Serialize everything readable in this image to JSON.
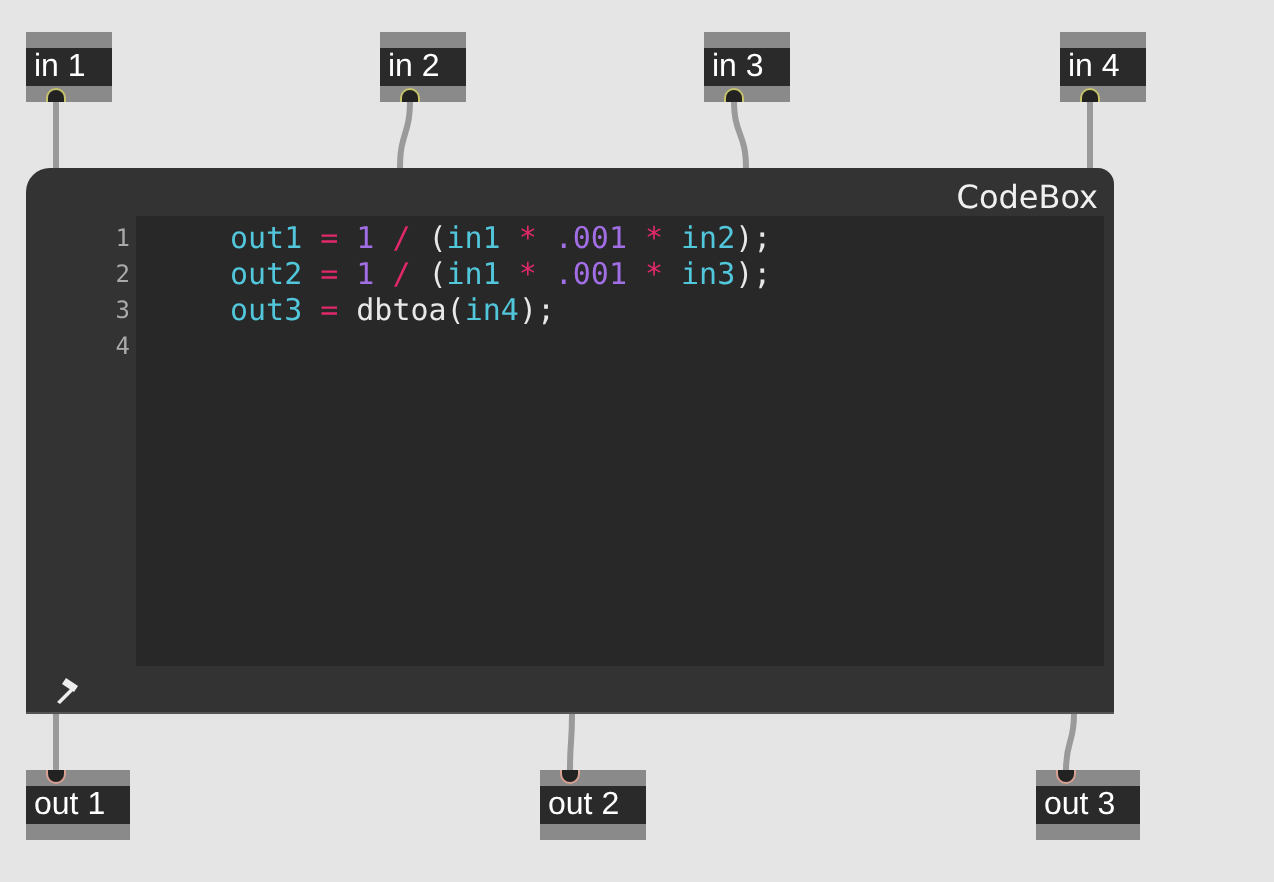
{
  "inlets": [
    {
      "label": "in 1"
    },
    {
      "label": "in 2"
    },
    {
      "label": "in 3"
    },
    {
      "label": "in 4"
    }
  ],
  "codebox": {
    "title": "CodeBox",
    "lines": [
      {
        "number": "1",
        "tokens": [
          {
            "kind": "ident",
            "text": "out1"
          },
          {
            "kind": "op",
            "text": "="
          },
          {
            "kind": "num",
            "text": "1"
          },
          {
            "kind": "op",
            "text": "/"
          },
          {
            "kind": "plain",
            "text": "("
          },
          {
            "kind": "ident",
            "text": "in1"
          },
          {
            "kind": "op",
            "text": "*"
          },
          {
            "kind": "num",
            "text": ".001"
          },
          {
            "kind": "op",
            "text": "*"
          },
          {
            "kind": "ident",
            "text": "in2"
          },
          {
            "kind": "plain",
            "text": ");"
          }
        ]
      },
      {
        "number": "2",
        "tokens": [
          {
            "kind": "ident",
            "text": "out2"
          },
          {
            "kind": "op",
            "text": "="
          },
          {
            "kind": "num",
            "text": "1"
          },
          {
            "kind": "op",
            "text": "/"
          },
          {
            "kind": "plain",
            "text": "("
          },
          {
            "kind": "ident",
            "text": "in1"
          },
          {
            "kind": "op",
            "text": "*"
          },
          {
            "kind": "num",
            "text": ".001"
          },
          {
            "kind": "op",
            "text": "*"
          },
          {
            "kind": "ident",
            "text": "in3"
          },
          {
            "kind": "plain",
            "text": ");"
          }
        ]
      },
      {
        "number": "3",
        "tokens": [
          {
            "kind": "ident",
            "text": "out3"
          },
          {
            "kind": "op",
            "text": "="
          },
          {
            "kind": "plain",
            "text": "dbtoa("
          },
          {
            "kind": "ident",
            "text": "in4"
          },
          {
            "kind": "plain",
            "text": ");"
          }
        ]
      },
      {
        "number": "4"
      }
    ]
  },
  "outlets": [
    {
      "label": "out 1"
    },
    {
      "label": "out 2"
    },
    {
      "label": "out 3"
    }
  ]
}
